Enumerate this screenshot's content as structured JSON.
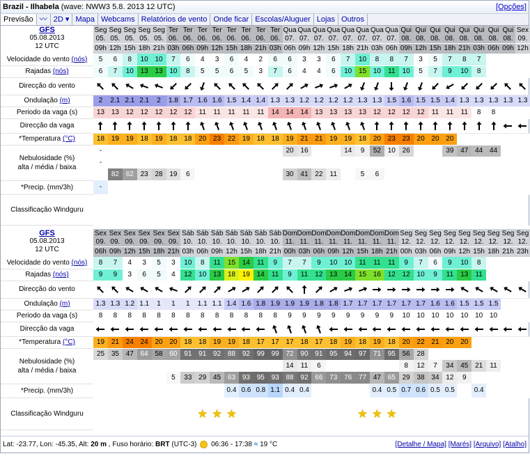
{
  "header": {
    "title": "Brazil - Ilhabela",
    "subtitle": "(wave: NWW3 5.8. 2013 12 UTC)",
    "options": "[Opções]"
  },
  "tabs": [
    "Previsão",
    "〰",
    "2D ▾",
    "Mapa",
    "Webcams",
    "Relatórios de vento",
    "Onde ficar",
    "Escolas/Aluguer",
    "Lojas",
    "Outros"
  ],
  "colors": {
    "accent": "#00a",
    "day_header_a": "#d0d4d8",
    "day_header_b": "#b8bcc0"
  },
  "labels": {
    "wind": "Velocidade do vento",
    "wind_unit": "(nós)",
    "gust": "Rajadas",
    "gust_unit": "(nós)",
    "wdir": "Direcção do vento",
    "wave": "Ondulação",
    "wave_unit": "(m)",
    "period": "Periodo da vaga (s)",
    "wvdir": "Direcção da vaga",
    "temp": "*Temperatura",
    "temp_unit": "(°C)",
    "cloud1": "Nebulosidade (%)",
    "cloud2": "alta / média / baixa",
    "precip": "*Precip. (mm/3h)",
    "rating": "Classificação Windguru"
  },
  "blocks": [
    {
      "model": "GFS",
      "date": "05.08.2013",
      "time": "12 UTC",
      "days": [
        "Seg",
        "Seg",
        "Seg",
        "Seg",
        "Seg",
        "Ter",
        "Ter",
        "Ter",
        "Ter",
        "Ter",
        "Ter",
        "Ter",
        "Ter",
        "Qua",
        "Qua",
        "Qua",
        "Qua",
        "Qua",
        "Qua",
        "Qua",
        "Qua",
        "Qui",
        "Qui",
        "Qui",
        "Qui",
        "Qui",
        "Qui",
        "Qui",
        "Qui",
        "Sex"
      ],
      "dates": [
        "05.",
        "05.",
        "05.",
        "05.",
        "05.",
        "06.",
        "06.",
        "06.",
        "06.",
        "06.",
        "06.",
        "06.",
        "06.",
        "07.",
        "07.",
        "07.",
        "07.",
        "07.",
        "07.",
        "07.",
        "07.",
        "08.",
        "08.",
        "08.",
        "08.",
        "08.",
        "08.",
        "08.",
        "08.",
        "09."
      ],
      "hours": [
        "09h",
        "12h",
        "15h",
        "18h",
        "21h",
        "03h",
        "06h",
        "09h",
        "12h",
        "15h",
        "18h",
        "21h",
        "03h",
        "06h",
        "09h",
        "12h",
        "15h",
        "18h",
        "21h",
        "03h",
        "06h",
        "09h",
        "12h",
        "15h",
        "18h",
        "21h",
        "03h",
        "06h",
        "09h",
        "12h"
      ],
      "wind": [
        "5",
        "6",
        "8",
        "10",
        "10",
        "7",
        "6",
        "4",
        "3",
        "6",
        "4",
        "2",
        "6",
        "6",
        "3",
        "3",
        "6",
        "7",
        "10",
        "8",
        "8",
        "7",
        "3",
        "5",
        "7",
        "8",
        "7",
        "",
        "",
        ""
      ],
      "gust": [
        "6",
        "7",
        "10",
        "13",
        "13",
        "10",
        "8",
        "5",
        "5",
        "6",
        "5",
        "3",
        "7",
        "6",
        "4",
        "4",
        "6",
        "10",
        "15",
        "10",
        "11",
        "10",
        "5",
        "7",
        "9",
        "10",
        "8",
        "",
        "",
        ""
      ],
      "wdir": [
        315,
        315,
        300,
        290,
        290,
        225,
        225,
        200,
        315,
        315,
        315,
        315,
        45,
        45,
        60,
        70,
        70,
        60,
        200,
        200,
        180,
        200,
        200,
        225,
        240,
        225,
        225,
        225,
        315,
        315
      ],
      "wave": [
        "2",
        "2.1",
        "2.1",
        "2.1",
        "2",
        "1.8",
        "1.7",
        "1.6",
        "1.6",
        "1.5",
        "1.4",
        "1.4",
        "1.3",
        "1.3",
        "1.2",
        "1.2",
        "1.2",
        "1.2",
        "1.3",
        "1.3",
        "1.5",
        "1.6",
        "1.5",
        "1.5",
        "1.4",
        "1.3",
        "1.3",
        "1.3",
        "1.3",
        "1.3"
      ],
      "period": [
        "13",
        "13",
        "12",
        "12",
        "12",
        "12",
        "12",
        "11",
        "11",
        "11",
        "11",
        "11",
        "14",
        "14",
        "14",
        "13",
        "13",
        "13",
        "13",
        "12",
        "12",
        "12",
        "12",
        "11",
        "11",
        "11",
        "8",
        "8",
        "",
        ""
      ],
      "wvdir": [
        0,
        0,
        0,
        0,
        0,
        0,
        0,
        340,
        340,
        340,
        340,
        340,
        340,
        340,
        340,
        340,
        340,
        340,
        340,
        0,
        0,
        0,
        0,
        0,
        0,
        0,
        0,
        0,
        270,
        270
      ],
      "temp": [
        "18",
        "19",
        "19",
        "18",
        "19",
        "18",
        "18",
        "20",
        "23",
        "22",
        "19",
        "18",
        "18",
        "19",
        "21",
        "21",
        "19",
        "19",
        "18",
        "20",
        "23",
        "23",
        "20",
        "20",
        "20",
        "",
        "",
        "",
        "",
        ""
      ],
      "cloud_h": [
        "-",
        "",
        "",
        "",
        "",
        "",
        "",
        "",
        "",
        "",
        "",
        "",
        "",
        "20",
        "16",
        "",
        "",
        "14",
        "9",
        "52",
        "10",
        "26",
        "",
        "",
        "39",
        "47",
        "44",
        "44",
        "",
        ""
      ],
      "cloud_m": [
        "-",
        "",
        "",
        "",
        "",
        "",
        "",
        "",
        "",
        "",
        "",
        "",
        "",
        "",
        "",
        "",
        "",
        "",
        "",
        "",
        "",
        "",
        "",
        "",
        "",
        "",
        "",
        "",
        "",
        ""
      ],
      "cloud_l": [
        "",
        "82",
        "62",
        "23",
        "28",
        "19",
        "6",
        "",
        "",
        "",
        "",
        "",
        "",
        "30",
        "41",
        "22",
        "11",
        "",
        "5",
        "6",
        "",
        "",
        "",
        "",
        "",
        "",
        "",
        "",
        "",
        ""
      ],
      "precip": [
        "-",
        "",
        "",
        "",
        "",
        "",
        "",
        "",
        "",
        "",
        "",
        "",
        "",
        "",
        "",
        "",
        "",
        "",
        "",
        "",
        "",
        "",
        "",
        "",
        "",
        "",
        "",
        "",
        "",
        ""
      ],
      "rating": [
        0,
        0,
        0,
        0,
        0,
        0,
        0,
        0,
        0,
        0,
        0,
        0,
        0,
        0,
        0,
        0,
        0,
        0,
        0,
        0,
        0,
        0,
        0,
        0,
        0,
        0,
        0,
        0,
        0,
        0
      ]
    },
    {
      "model": "GFS",
      "date": "05.08.2013",
      "time": "12 UTC",
      "days": [
        "Sex",
        "Sex",
        "Sex",
        "Sex",
        "Sex",
        "Sex",
        "Sáb",
        "Sáb",
        "Sáb",
        "Sáb",
        "Sáb",
        "Sáb",
        "Sáb",
        "Dom",
        "Dom",
        "Dom",
        "Dom",
        "Dom",
        "Dom",
        "Dom",
        "Dom",
        "Seg",
        "Seg",
        "Seg",
        "Seg",
        "Seg",
        "Seg",
        "Seg",
        "Seg",
        "Seg"
      ],
      "dates": [
        "09.",
        "09.",
        "09.",
        "09.",
        "09.",
        "09.",
        "10.",
        "10.",
        "10.",
        "10.",
        "10.",
        "10.",
        "10.",
        "11.",
        "11.",
        "11.",
        "11.",
        "11.",
        "11.",
        "11.",
        "11.",
        "12.",
        "12.",
        "12.",
        "12.",
        "12.",
        "12.",
        "12.",
        "12.",
        "12."
      ],
      "hours": [
        "06h",
        "09h",
        "12h",
        "15h",
        "18h",
        "21h",
        "03h",
        "06h",
        "09h",
        "12h",
        "15h",
        "18h",
        "21h",
        "00h",
        "03h",
        "06h",
        "09h",
        "12h",
        "15h",
        "18h",
        "21h",
        "00h",
        "03h",
        "06h",
        "09h",
        "12h",
        "15h",
        "18h",
        "21h",
        "23h"
      ],
      "wind": [
        "8",
        "7",
        "4",
        "3",
        "5",
        "3",
        "10",
        "8",
        "11",
        "15",
        "14",
        "11",
        "9",
        "7",
        "7",
        "9",
        "10",
        "10",
        "11",
        "11",
        "11",
        "9",
        "7",
        "6",
        "9",
        "10",
        "8",
        "",
        "",
        ""
      ],
      "gust": [
        "9",
        "9",
        "3",
        "6",
        "5",
        "4",
        "12",
        "10",
        "13",
        "18",
        "19",
        "14",
        "11",
        "9",
        "11",
        "12",
        "13",
        "14",
        "15",
        "16",
        "12",
        "12",
        "10",
        "9",
        "11",
        "13",
        "11",
        "",
        "",
        ""
      ],
      "wdir": [
        315,
        315,
        300,
        300,
        300,
        290,
        45,
        45,
        45,
        60,
        60,
        45,
        45,
        315,
        0,
        45,
        60,
        70,
        70,
        90,
        90,
        90,
        90,
        90,
        90,
        300,
        300,
        300,
        300,
        300
      ],
      "wave": [
        "1.3",
        "1.3",
        "1.2",
        "1.1",
        "1",
        "1",
        "1",
        "1.1",
        "1.1",
        "1.4",
        "1.6",
        "1.8",
        "1.9",
        "1.9",
        "1.9",
        "1.8",
        "1.8",
        "1.7",
        "1.7",
        "1.7",
        "1.7",
        "1.7",
        "1.7",
        "1.6",
        "1.6",
        "1.5",
        "1.5",
        "1.5",
        "",
        ""
      ],
      "period": [
        "8",
        "8",
        "8",
        "8",
        "8",
        "8",
        "8",
        "8",
        "8",
        "8",
        "8",
        "8",
        "8",
        "9",
        "9",
        "9",
        "9",
        "9",
        "9",
        "9",
        "9",
        "10",
        "10",
        "10",
        "10",
        "10",
        "10",
        "10",
        "",
        ""
      ],
      "wvdir": [
        270,
        270,
        270,
        270,
        270,
        270,
        270,
        270,
        270,
        270,
        270,
        270,
        340,
        340,
        340,
        340,
        270,
        270,
        270,
        270,
        270,
        270,
        270,
        270,
        270,
        270,
        270,
        270,
        270,
        270
      ],
      "temp": [
        "19",
        "21",
        "24",
        "24",
        "20",
        "20",
        "18",
        "18",
        "19",
        "19",
        "18",
        "17",
        "17",
        "17",
        "18",
        "17",
        "18",
        "19",
        "18",
        "19",
        "18",
        "20",
        "22",
        "21",
        "20",
        "20",
        "",
        "",
        "",
        ""
      ],
      "cloud_h": [
        "25",
        "35",
        "47",
        "64",
        "58",
        "60",
        "91",
        "91",
        "92",
        "88",
        "92",
        "99",
        "99",
        "72",
        "90",
        "91",
        "95",
        "94",
        "97",
        "71",
        "95",
        "56",
        "28",
        "",
        "",
        "",
        "",
        "",
        "",
        ""
      ],
      "cloud_m": [
        "",
        "",
        "",
        "",
        "",
        "",
        "",
        "",
        "",
        "",
        "",
        "",
        "",
        "14",
        "11",
        "6",
        "",
        "",
        "",
        "",
        "",
        "8",
        "12",
        "7",
        "34",
        "45",
        "21",
        "11",
        "",
        ""
      ],
      "cloud_l": [
        "",
        "",
        "",
        "",
        "",
        "5",
        "33",
        "29",
        "45",
        "63",
        "93",
        "95",
        "93",
        "88",
        "92",
        "66",
        "73",
        "76",
        "77",
        "47",
        "65",
        "29",
        "38",
        "34",
        "12",
        "9",
        "",
        "",
        "",
        ""
      ],
      "precip": [
        "",
        "",
        "",
        "",
        "",
        "",
        "",
        "",
        "",
        "0.4",
        "0.6",
        "0.8",
        "1.1",
        "0.4",
        "0.4",
        "",
        "",
        "",
        "",
        "0.4",
        "0.5",
        "0.7",
        "0.6",
        "0.5",
        "0.5",
        "",
        "0.4",
        "",
        "",
        ""
      ],
      "rating": [
        0,
        0,
        0,
        0,
        0,
        0,
        0,
        1,
        1,
        1,
        0,
        0,
        0,
        0,
        0,
        0,
        0,
        0,
        1,
        1,
        1,
        0,
        0,
        0,
        0,
        0,
        0,
        0,
        0,
        0
      ]
    }
  ],
  "footer": {
    "lat": "Lat: -23.77, Lon: -45.35, Alt:",
    "alt": "20 m",
    "tz": ", Fuso horário:",
    "tzcode": "BRT",
    "tzoff": "(UTC-3)",
    "sun": "06:36 - 17:38",
    "water": "19 °C",
    "links": [
      "[Detalhe / Mapa]",
      "[Marés]",
      "[Arquivo]",
      "[Atalho]"
    ]
  }
}
